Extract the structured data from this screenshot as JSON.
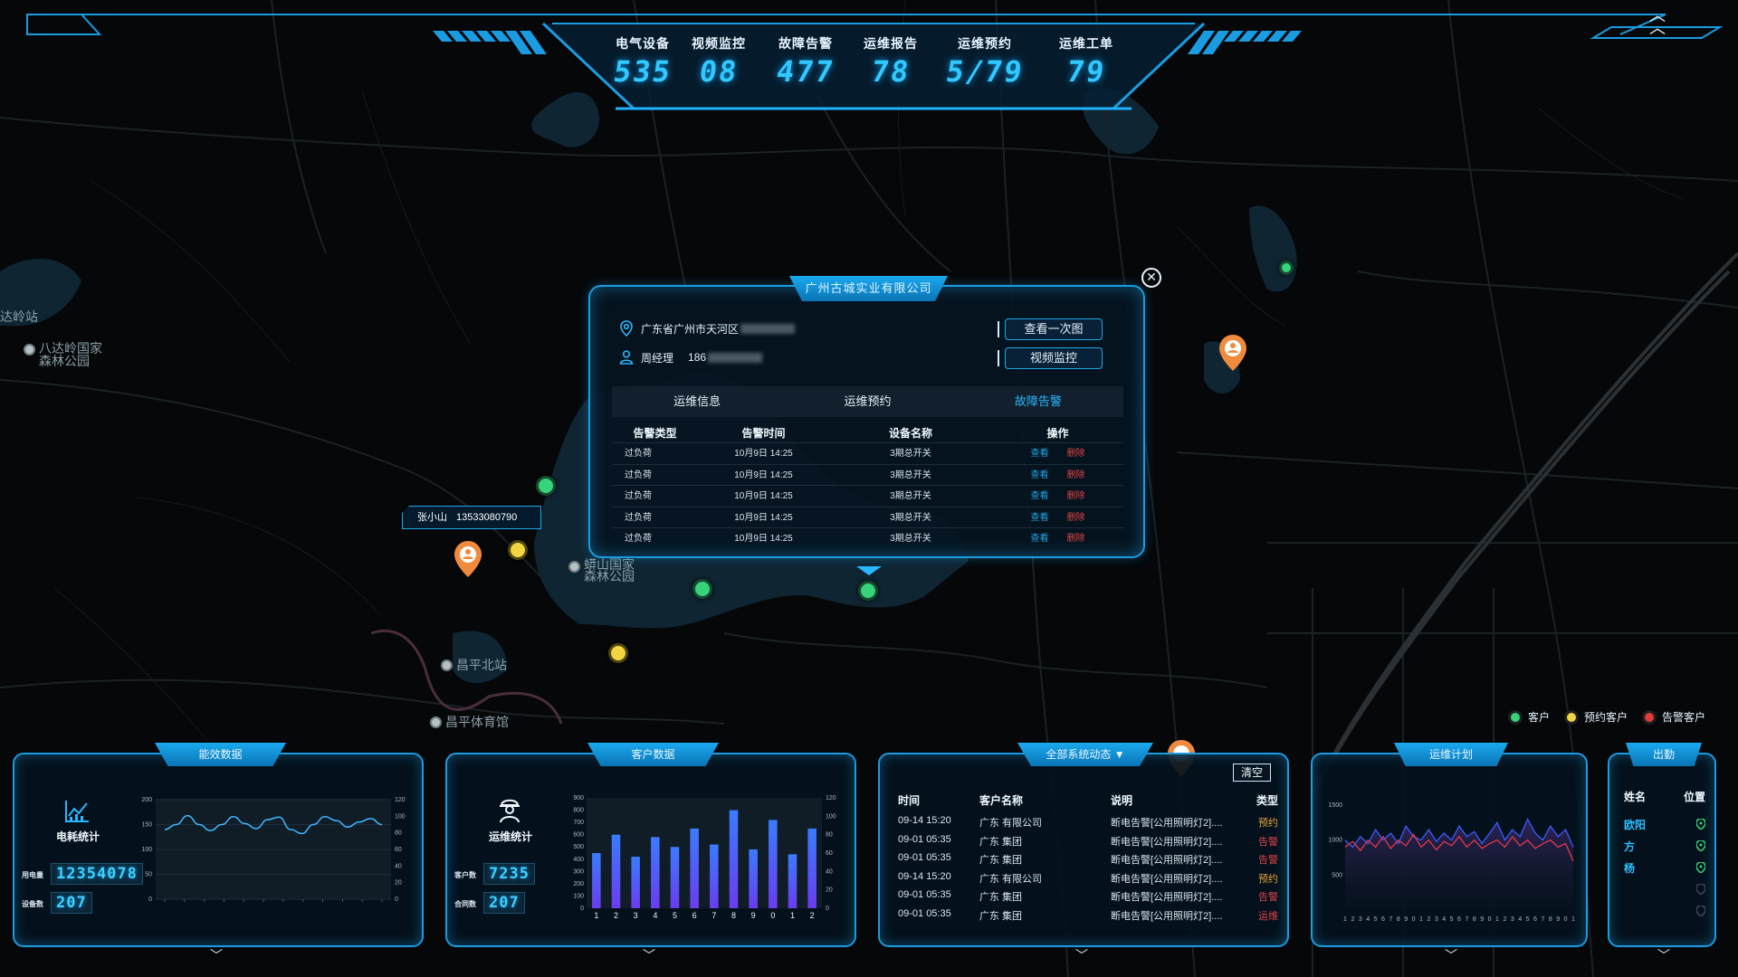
{
  "header": {
    "stats": [
      {
        "label": "电气设备",
        "value": "535"
      },
      {
        "label": "视频监控",
        "value": "08"
      },
      {
        "label": "故障告警",
        "value": "477"
      },
      {
        "label": "运维报告",
        "value": "78"
      },
      {
        "label": "运维预约",
        "value": "5/79"
      },
      {
        "label": "运维工单",
        "value": "79"
      }
    ],
    "collapse_icon": "double-chevron-up-icon"
  },
  "map": {
    "places": [
      {
        "label": "八达岭国家森林公园"
      },
      {
        "label": "蟒山国家森林公园"
      },
      {
        "label": "昌平北站"
      },
      {
        "label": "昌平体育馆"
      },
      {
        "label": "达岭站"
      }
    ],
    "person_tag": {
      "name": "张小山",
      "phone": "13533080790"
    },
    "colors": {
      "customer": "#37d27a",
      "reserved": "#f1d640",
      "alarm": "#e33b3b",
      "accent": "#1b9be0",
      "value": "#30c9ff"
    }
  },
  "popup": {
    "title": "广州古城实业有限公司",
    "address": "广东省广州市天河区",
    "contact_name": "周经理",
    "contact_phone": "186",
    "btn_diagram": "查看一次图",
    "btn_video": "视频监控",
    "tabs": [
      "运维信息",
      "运维预约",
      "故障告警"
    ],
    "active_tab": "故障告警",
    "table": {
      "headers": [
        "告警类型",
        "告警时间",
        "设备名称",
        "操作"
      ],
      "rows": [
        {
          "type": "过负荷",
          "time": "10月9日  14:25",
          "device": "3期总开关",
          "view": "查看",
          "del": "删除"
        },
        {
          "type": "过负荷",
          "time": "10月9日  14:25",
          "device": "3期总开关",
          "view": "查看",
          "del": "删除"
        },
        {
          "type": "过负荷",
          "time": "10月9日  14:25",
          "device": "3期总开关",
          "view": "查看",
          "del": "删除"
        },
        {
          "type": "过负荷",
          "time": "10月9日  14:25",
          "device": "3期总开关",
          "view": "查看",
          "del": "删除"
        },
        {
          "type": "过负荷",
          "time": "10月9日  14:25",
          "device": "3期总开关",
          "view": "查看",
          "del": "删除"
        }
      ]
    }
  },
  "legend": [
    {
      "label": "客户",
      "color": "#37d27a"
    },
    {
      "label": "预约客户",
      "color": "#f1d640"
    },
    {
      "label": "告警客户",
      "color": "#e33b3b"
    }
  ],
  "panels": {
    "energy": {
      "title": "能效数据",
      "kpi_title": "电耗统计",
      "power_label": "用电量",
      "power_value": "12354078",
      "device_label": "设备数",
      "device_value": "207"
    },
    "customer": {
      "title": "客户数据",
      "kpi_title": "运维统计",
      "customer_label": "客户数",
      "customer_value": "7235",
      "contract_label": "合同数",
      "contract_value": "207"
    },
    "feed": {
      "title": "全部系统动态",
      "clear": "清空",
      "headers": [
        "时间",
        "客户名称",
        "说明",
        "类型"
      ],
      "rows": [
        {
          "time": "09-14  15:20",
          "name": "广东        有限公司",
          "desc": "断电告警[公用照明灯2]....",
          "type": "预约",
          "color": "#e8a23a"
        },
        {
          "time": "09-01  05:35",
          "name": "广东        集团",
          "desc": "断电告警[公用照明灯2]....",
          "type": "告警",
          "color": "#e04545"
        },
        {
          "time": "09-01  05:35",
          "name": "广东        集团",
          "desc": "断电告警[公用照明灯2]....",
          "type": "告警",
          "color": "#e04545"
        },
        {
          "time": "09-14  15:20",
          "name": "广东        有限公司",
          "desc": "断电告警[公用照明灯2]....",
          "type": "预约",
          "color": "#e8a23a"
        },
        {
          "time": "09-01  05:35",
          "name": "广东        集团",
          "desc": "断电告警[公用照明灯2]....",
          "type": "告警",
          "color": "#e04545"
        },
        {
          "time": "09-01  05:35",
          "name": "广东        集团",
          "desc": "断电告警[公用照明灯2]....",
          "type": "运维",
          "color": "#e04545"
        }
      ]
    },
    "plan": {
      "title": "运维计划"
    },
    "attendance": {
      "title": "出勤",
      "headers": [
        "姓名",
        "位置"
      ],
      "rows": [
        {
          "name": "欧阳",
          "active": true
        },
        {
          "name": "方",
          "active": true
        },
        {
          "name": "杨",
          "active": true
        },
        {
          "name": "",
          "active": false
        },
        {
          "name": "",
          "active": false
        }
      ]
    }
  },
  "chart_data": [
    {
      "type": "line",
      "ylim": [
        0,
        200
      ],
      "y2lim": [
        0,
        120
      ],
      "yticks": [
        0,
        50,
        100,
        150,
        200
      ],
      "y2ticks": [
        0,
        20,
        40,
        60,
        80,
        100,
        120
      ],
      "values": [
        140,
        150,
        168,
        150,
        138,
        150,
        166,
        152,
        142,
        160,
        165,
        140,
        132,
        150,
        166,
        158,
        145,
        155,
        162,
        150
      ]
    },
    {
      "type": "bar",
      "categories": [
        "1",
        "2",
        "3",
        "4",
        "5",
        "6",
        "7",
        "8",
        "9",
        "0",
        "1",
        "2"
      ],
      "values": [
        450,
        600,
        420,
        580,
        500,
        650,
        520,
        800,
        480,
        720,
        440,
        650
      ],
      "ylim": [
        0,
        900
      ],
      "yticks": [
        0,
        100,
        200,
        300,
        400,
        500,
        600,
        700,
        800,
        900
      ],
      "y2ticks": [
        0,
        20,
        40,
        60,
        80,
        100,
        120
      ]
    },
    {
      "type": "line",
      "ylim": [
        0,
        1500
      ],
      "yticks": [
        500,
        1000,
        1500
      ],
      "categories": [
        "1",
        "2",
        "3",
        "4",
        "5",
        "6",
        "7",
        "8",
        "9",
        "0",
        "1",
        "2",
        "3",
        "4",
        "5",
        "6",
        "7",
        "8",
        "9",
        "0",
        "1",
        "2",
        "3",
        "4",
        "5",
        "6",
        "7",
        "8",
        "9",
        "0",
        "1"
      ],
      "series": [
        {
          "values": [
            1000,
            900,
            1050,
            950,
            1150,
            1000,
            1100,
            950,
            1200,
            1050,
            1000,
            1150,
            980,
            1100,
            1000,
            1200,
            1050,
            1120,
            950,
            1100,
            1250,
            1000,
            1150,
            1050,
            1300,
            1100,
            1000,
            1200,
            1050,
            1150,
            900
          ]
        },
        {
          "values": [
            900,
            980,
            850,
            1000,
            900,
            1050,
            880,
            1000,
            920,
            1080,
            900,
            1000,
            860,
            980,
            920,
            1050,
            900,
            1000,
            880,
            950,
            1000,
            900,
            1050,
            920,
            1000,
            880,
            950,
            1000,
            900,
            950,
            700
          ]
        }
      ]
    }
  ]
}
